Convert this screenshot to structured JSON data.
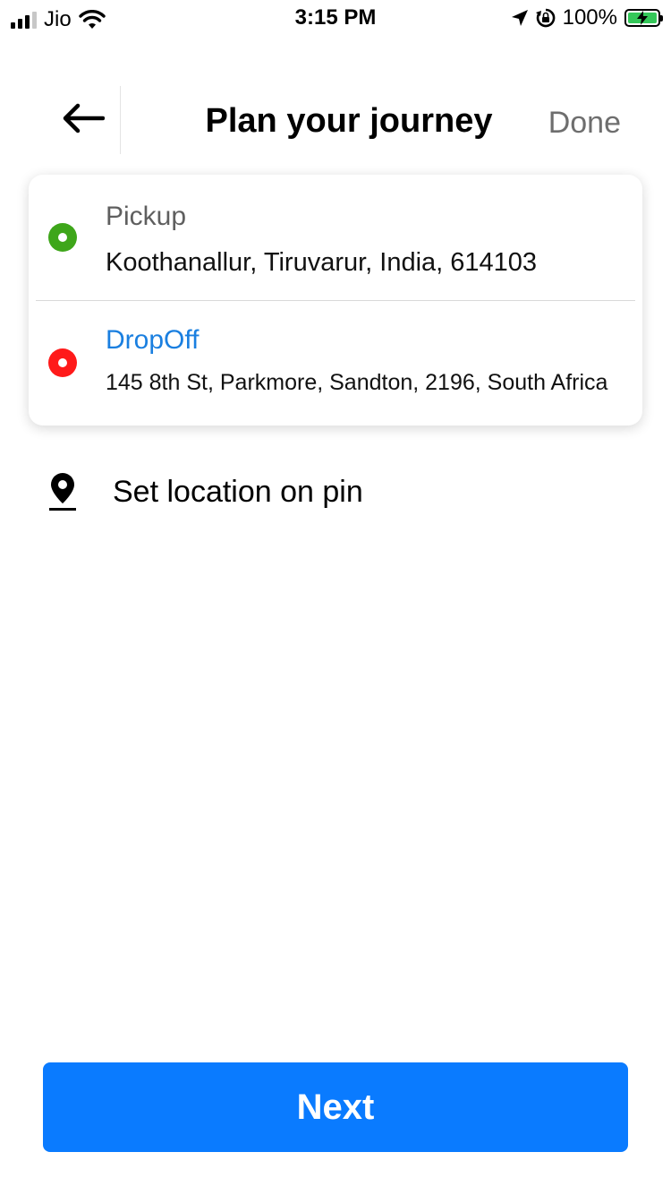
{
  "status_bar": {
    "carrier": "Jio",
    "time": "3:15 PM",
    "battery": "100%",
    "icons": [
      "signal-icon",
      "wifi-icon",
      "location-arrow-icon",
      "orientation-lock-icon",
      "battery-charging-icon"
    ]
  },
  "header": {
    "title": "Plan your journey",
    "done_label": "Done",
    "back_icon": "back-arrow-icon"
  },
  "locations": {
    "pickup": {
      "label": "Pickup",
      "address": "Koothanallur, Tiruvarur, India, 614103",
      "dot_color": "#3ea61a",
      "label_color": "#5f5f5f"
    },
    "dropoff": {
      "label": "DropOff",
      "address": "145 8th St, Parkmore, Sandton, 2196, South Africa",
      "dot_color": "#ff1a1a",
      "label_color": "#1a7fe0"
    }
  },
  "pin_option": {
    "label": "Set location on pin",
    "icon": "map-pin-icon"
  },
  "next_button": {
    "label": "Next",
    "color": "#0a7bff"
  }
}
